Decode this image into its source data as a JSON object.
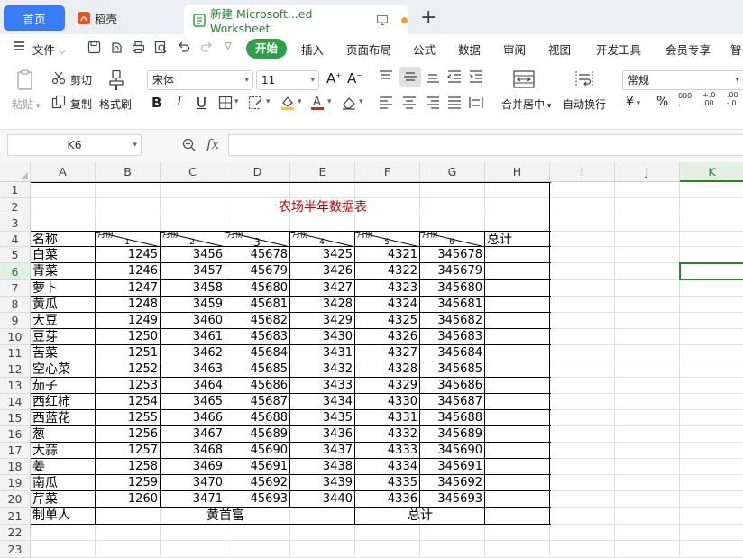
{
  "tabs": {
    "home": "首页",
    "daoke": "稻壳",
    "doc": "新建 Microsoft...ed Worksheet"
  },
  "menu": {
    "file": "文件",
    "start": "开始",
    "insert": "插入",
    "layout": "页面布局",
    "formula": "公式",
    "data": "数据",
    "review": "审阅",
    "view": "视图",
    "dev": "开发工具",
    "vip": "会员专享",
    "smart": "智"
  },
  "toolbar": {
    "paste": "粘贴",
    "cut": "剪切",
    "copy": "复制",
    "format_painter": "格式刷",
    "font": "宋体",
    "font_size": "11",
    "merge": "合并居中",
    "wrap": "自动换行",
    "num_format": "常规",
    "currency": "¥",
    "percent": "%"
  },
  "formula_bar": {
    "name_box": "K6",
    "fx": "fx",
    "value": ""
  },
  "columns": [
    "A",
    "B",
    "C",
    "D",
    "E",
    "F",
    "G",
    "H",
    "I",
    "J",
    "K"
  ],
  "rows": [
    "1",
    "2",
    "3",
    "4",
    "5",
    "6",
    "7",
    "8",
    "9",
    "10",
    "11",
    "12",
    "13",
    "14",
    "15",
    "16",
    "17",
    "18",
    "19",
    "20",
    "21",
    "22",
    "23"
  ],
  "selection": {
    "cell": "K6",
    "color": "#2e7d32"
  },
  "sheet": {
    "title": "农场半年数据表",
    "title_color": "#c00000",
    "header_name": "名称",
    "header_total": "总计",
    "header_corner": "月份",
    "months": [
      "1",
      "2",
      "3",
      "4",
      "5",
      "6"
    ],
    "items": [
      {
        "name": "白菜",
        "v": [
          "1245",
          "3456",
          "45678",
          "3425",
          "4321",
          "345678"
        ]
      },
      {
        "name": "青菜",
        "v": [
          "1246",
          "3457",
          "45679",
          "3426",
          "4322",
          "345679"
        ]
      },
      {
        "name": "萝卜",
        "v": [
          "1247",
          "3458",
          "45680",
          "3427",
          "4323",
          "345680"
        ]
      },
      {
        "name": "黄瓜",
        "v": [
          "1248",
          "3459",
          "45681",
          "3428",
          "4324",
          "345681"
        ]
      },
      {
        "name": "大豆",
        "v": [
          "1249",
          "3460",
          "45682",
          "3429",
          "4325",
          "345682"
        ]
      },
      {
        "name": "豆芽",
        "v": [
          "1250",
          "3461",
          "45683",
          "3430",
          "4326",
          "345683"
        ]
      },
      {
        "name": "苦菜",
        "v": [
          "1251",
          "3462",
          "45684",
          "3431",
          "4327",
          "345684"
        ]
      },
      {
        "name": "空心菜",
        "v": [
          "1252",
          "3463",
          "45685",
          "3432",
          "4328",
          "345685"
        ]
      },
      {
        "name": "茄子",
        "v": [
          "1253",
          "3464",
          "45686",
          "3433",
          "4329",
          "345686"
        ]
      },
      {
        "name": "西红柿",
        "v": [
          "1254",
          "3465",
          "45687",
          "3434",
          "4330",
          "345687"
        ]
      },
      {
        "name": "西蓝花",
        "v": [
          "1255",
          "3466",
          "45688",
          "3435",
          "4331",
          "345688"
        ]
      },
      {
        "name": "葱",
        "v": [
          "1256",
          "3467",
          "45689",
          "3436",
          "4332",
          "345689"
        ]
      },
      {
        "name": "大蒜",
        "v": [
          "1257",
          "3468",
          "45690",
          "3437",
          "4333",
          "345690"
        ]
      },
      {
        "name": "姜",
        "v": [
          "1258",
          "3469",
          "45691",
          "3438",
          "4334",
          "345691"
        ]
      },
      {
        "name": "南瓜",
        "v": [
          "1259",
          "3470",
          "45692",
          "3439",
          "4335",
          "345692"
        ]
      },
      {
        "name": "芹菜",
        "v": [
          "1260",
          "3471",
          "45693",
          "3440",
          "4336",
          "345693"
        ]
      }
    ],
    "footer": {
      "maker_label": "制单人",
      "maker": "黄首富",
      "total_label": "总计"
    }
  }
}
